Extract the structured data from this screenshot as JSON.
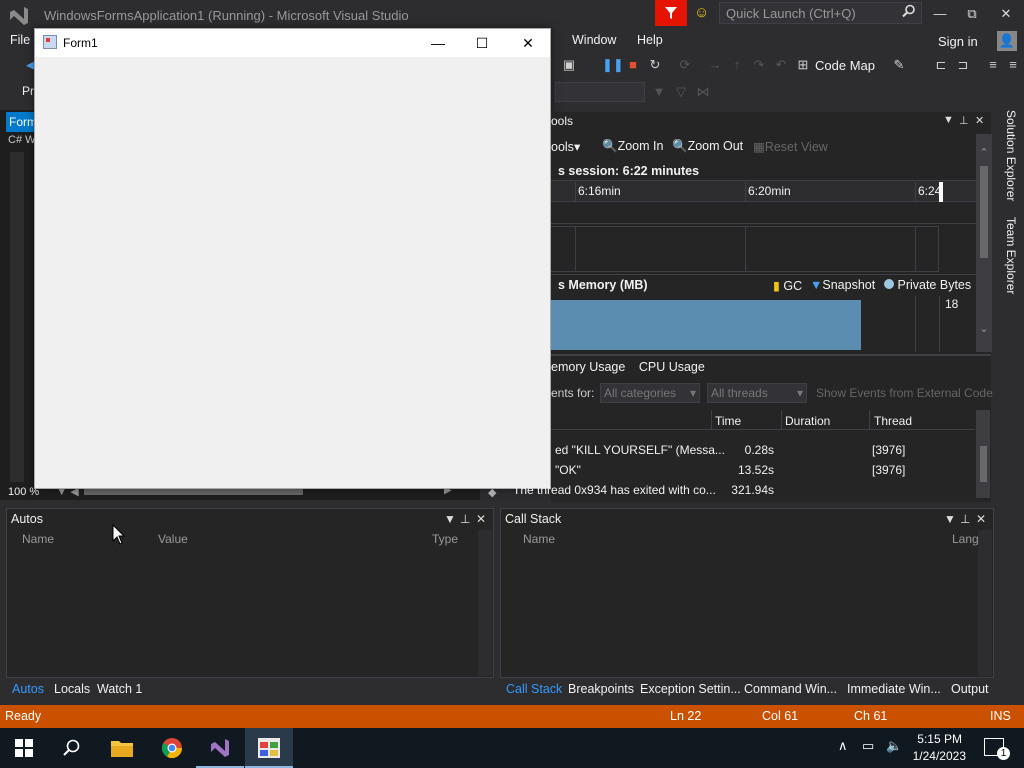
{
  "window": {
    "title": "WindowsFormsApplication1 (Running) - Microsoft Visual Studio",
    "quick_launch_placeholder": "Quick Launch (Ctrl+Q)",
    "minimize": "—",
    "maximize": "⧉",
    "close": "✕"
  },
  "menu": {
    "file": "File",
    "window": "Window",
    "help": "Help",
    "sign_in": "Sign in"
  },
  "toolbar": {
    "code_map": "Code Map",
    "partial_label": "Pr"
  },
  "left_doc": {
    "tab_label": "Form",
    "nav_label": "C# W",
    "zoom": "100 %"
  },
  "form1": {
    "title": "Form1",
    "minimize": "—",
    "maximize": "☐",
    "close": "✕"
  },
  "diagnostics": {
    "header": "ools",
    "tools_menu": "ools",
    "zoom_in": "Zoom In",
    "zoom_out": "Zoom Out",
    "reset_view": "Reset View",
    "session": "s session: 6:22 minutes",
    "ticks": [
      "6:16min",
      "6:20min",
      "6:24"
    ],
    "memory_header": "s Memory (MB)",
    "legend_gc": "GC",
    "legend_snapshot": "Snapshot",
    "legend_private_bytes": "Private Bytes",
    "memory_value": "18",
    "tabs": [
      "emory Usage",
      "CPU Usage"
    ],
    "events_for": "ents for:",
    "category_filter": "All categories",
    "thread_filter": "All threads",
    "external_code": "Show Events from External Code",
    "columns": {
      "time": "Time",
      "duration": "Duration",
      "thread": "Thread"
    },
    "events": [
      {
        "text": "ed \"KILL YOURSELF\" (Messa...",
        "time": "0.28s",
        "thread": "[3976]"
      },
      {
        "text": "\"OK\"",
        "time": "13.52s",
        "thread": "[3976]"
      },
      {
        "text": "The thread 0x934 has exited with co...",
        "time": "321.94s",
        "thread": ""
      }
    ]
  },
  "autos": {
    "title": "Autos",
    "columns": {
      "name": "Name",
      "value": "Value",
      "type": "Type"
    },
    "tabs": [
      "Autos",
      "Locals",
      "Watch 1"
    ]
  },
  "call_stack": {
    "title": "Call Stack",
    "columns": {
      "name": "Name",
      "lang": "Lang"
    },
    "tabs": [
      "Call Stack",
      "Breakpoints",
      "Exception Settin...",
      "Command Win...",
      "Immediate Win...",
      "Output"
    ]
  },
  "side_tabs": [
    "Solution Explorer",
    "Team Explorer"
  ],
  "status": {
    "ready": "Ready",
    "line": "Ln 22",
    "col": "Col 61",
    "ch": "Ch 61",
    "ins": "INS"
  },
  "taskbar": {
    "time": "5:15 PM",
    "date": "1/24/2023",
    "notifications": "1"
  }
}
